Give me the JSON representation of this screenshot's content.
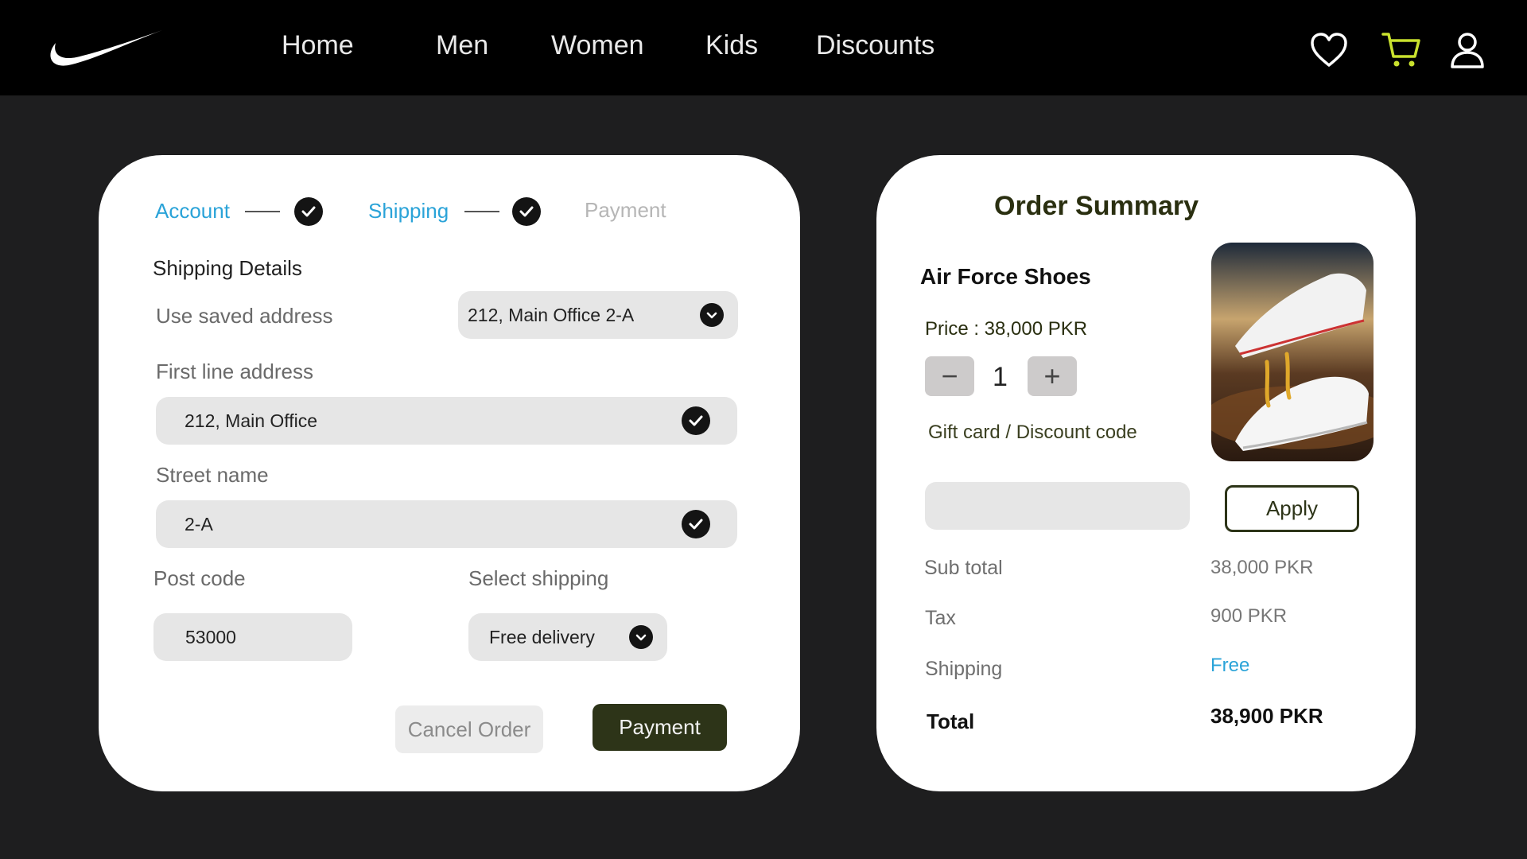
{
  "nav": {
    "brand": "Nike",
    "links": [
      "Home",
      "Men",
      "Women",
      "Kids",
      "Discounts"
    ],
    "icons": [
      "heart-icon",
      "cart-icon",
      "user-icon"
    ],
    "cart_accent": "#c9e12e"
  },
  "checkout": {
    "steps": [
      {
        "label": "Account",
        "state": "done"
      },
      {
        "label": "Shipping",
        "state": "done"
      },
      {
        "label": "Payment",
        "state": "pending"
      }
    ],
    "section_title": "Shipping Details",
    "saved_address_label": "Use saved address",
    "saved_address_value": "212, Main Office 2-A",
    "first_line_label": "First line address",
    "first_line_value": "212, Main Office",
    "street_label": "Street name",
    "street_value": "2-A",
    "postcode_label": "Post code",
    "postcode_value": "53000",
    "shipping_label": "Select shipping",
    "shipping_value": "Free delivery",
    "cancel_label": "Cancel Order",
    "payment_label": "Payment"
  },
  "summary": {
    "title": "Order Summary",
    "product_name": "Air Force Shoes",
    "price": "Price : 38,000 PKR",
    "quantity": "1",
    "minus": "−",
    "plus": "+",
    "gift_label": "Gift card / Discount code",
    "gift_value": "",
    "apply_label": "Apply",
    "subtotal_label": "Sub total",
    "subtotal_value": "38,000 PKR",
    "tax_label": "Tax",
    "tax_value": "900 PKR",
    "shipping_label": "Shipping",
    "shipping_value": "Free",
    "total_label": "Total",
    "total_value": "38,900 PKR"
  },
  "colors": {
    "step_done": "#2aa3d8",
    "primary_button": "#2d3418",
    "background": "#1e1e1f"
  }
}
